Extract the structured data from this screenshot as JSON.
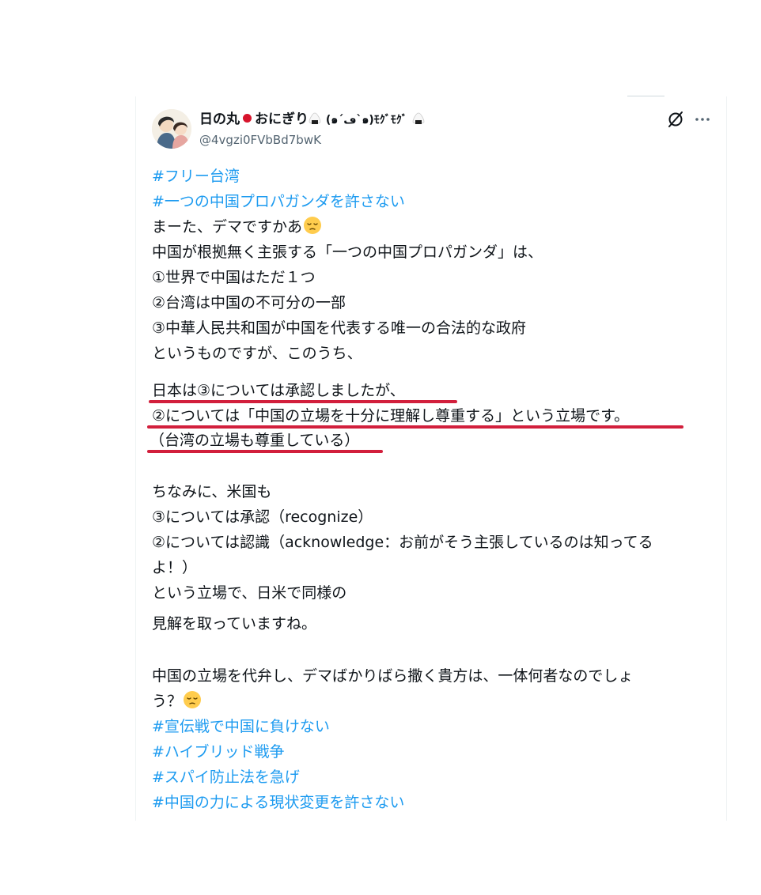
{
  "tweet": {
    "display_name": "日の丸",
    "display_name_mid": "おにぎり",
    "display_name_kaomoji": "(๑´ڡ`๑)ﾓｸﾞﾓｸﾞ",
    "handle": "@4vgzi0FVbBd7bwK",
    "icons": {
      "grok": "grok-icon",
      "more": "more-icon",
      "emoji_face": "pensive-face-icon",
      "onigiri": "onigiri-icon",
      "flag": "japan-flag-icon"
    },
    "lines": {
      "l1": "#フリー台湾",
      "l2": "#一つの中国プロパガンダを許さない",
      "l3": "まーた、デマですかあ",
      "l4": "中国が根拠無く主張する「一つの中国プロパガンダ」は、",
      "l5": "①世界で中国はただ１つ",
      "l6": "②台湾は中国の不可分の一部",
      "l7": "③中華人民共和国が中国を代表する唯一の合法的な政府",
      "l8": "というものですが、このうち、",
      "l9": "日本は③については承認しましたが、",
      "l10": "②については「中国の立場を十分に理解し尊重する」という立場です。",
      "l11": "（台湾の立場も尊重している）",
      "l12": "ちなみに、米国も",
      "l13": "③については承認（recognize）",
      "l14": "②については認識（acknowledge：お前がそう主張しているのは知ってる",
      "l15": "よ！）",
      "l16": "という立場で、日米で同様の",
      "l17": "見解を取っていますね。",
      "l18": "中国の立場を代弁し、デマばかりばら撒く貴方は、一体何者なのでしょ",
      "l19": "う？",
      "l20": "#宣伝戦で中国に負けない",
      "l21": "#ハイブリッド戦争",
      "l22": "#スパイ防止法を急げ",
      "l23": "#中国の力による現状変更を許さない"
    },
    "colors": {
      "hashtag": "#1d9bf0",
      "text": "#0f1419",
      "handle": "#536471",
      "underline": "#d21f3c"
    }
  }
}
